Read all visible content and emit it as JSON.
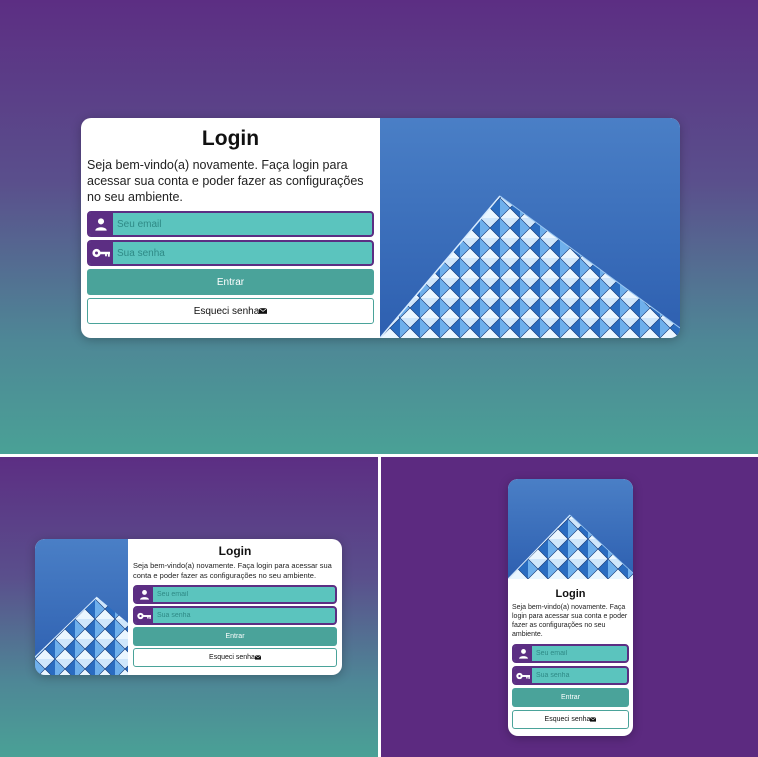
{
  "login": {
    "title": "Login",
    "intro": "Seja bem-vindo(a) novamente. Faça login para acessar sua conta e poder fazer as configurações no seu ambiente.",
    "email_placeholder": "Seu email",
    "password_placeholder": "Sua senha",
    "submit_label": "Entrar",
    "forgot_label": "Esqueci senha"
  },
  "icons": {
    "email_field": "user-icon",
    "password_field": "key-icon",
    "forgot_button": "envelope-icon",
    "photo": "glass-pyramid-building"
  },
  "colors": {
    "background_top": "#5c2e83",
    "background_bottom": "#4aa196",
    "background_solid": "#5c2a80",
    "field_fill": "#5bc4be",
    "field_border": "#5c2e83",
    "icon_cell": "#5c2e83",
    "primary_button": "#4aa39a",
    "card": "#ffffff",
    "sky": "#3a6fb8"
  }
}
